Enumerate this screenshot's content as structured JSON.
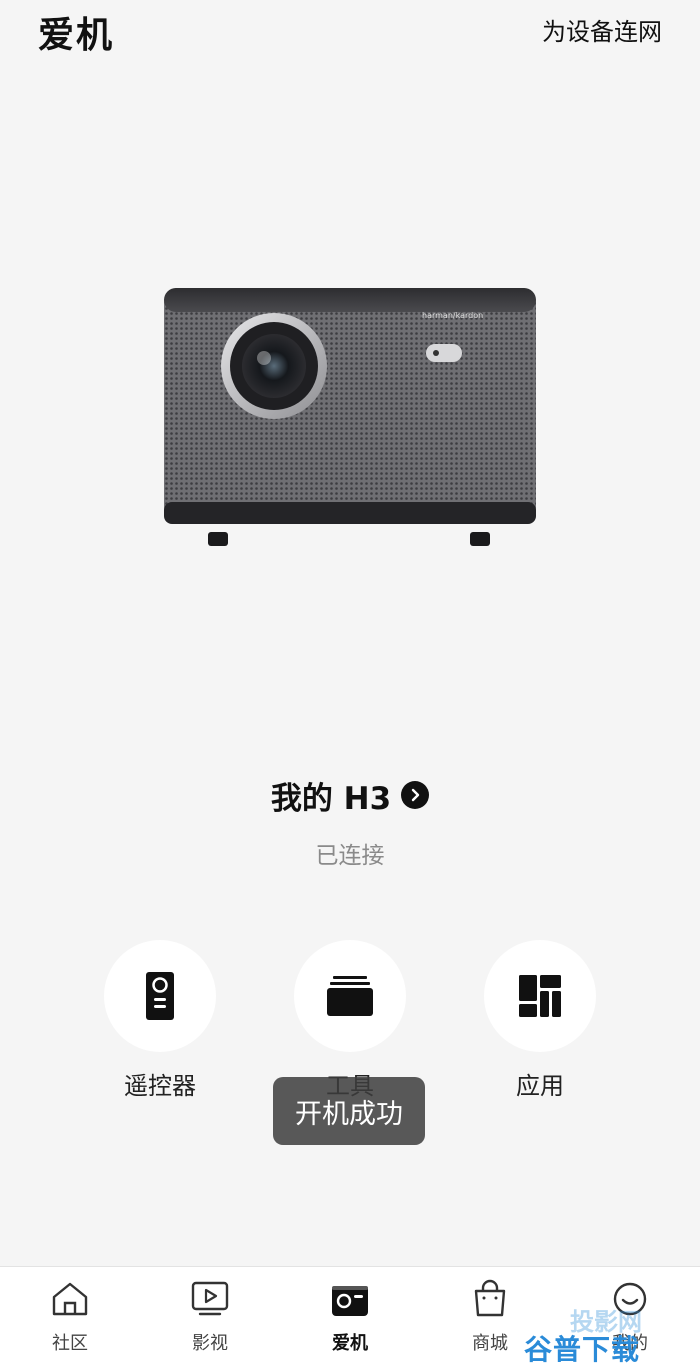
{
  "header": {
    "title": "爱机",
    "network_link": "为设备连网"
  },
  "device": {
    "name": "我的 H3",
    "status": "已连接",
    "brand_mark": "harman/kardon"
  },
  "actions": [
    {
      "label": "遥控器",
      "icon": "remote-control-icon"
    },
    {
      "label": "工具",
      "icon": "tools-icon"
    },
    {
      "label": "应用",
      "icon": "apps-grid-icon"
    }
  ],
  "toast": {
    "text": "开机成功"
  },
  "tabbar": [
    {
      "label": "社区",
      "icon": "home-icon",
      "active": false
    },
    {
      "label": "影视",
      "icon": "video-play-icon",
      "active": false
    },
    {
      "label": "爱机",
      "icon": "projector-icon",
      "active": true
    },
    {
      "label": "商城",
      "icon": "shopping-bag-icon",
      "active": false
    },
    {
      "label": "我的",
      "icon": "smiley-face-icon",
      "active": false
    }
  ],
  "watermark": {
    "text": "谷普下载",
    "text2": "投影网"
  },
  "colors": {
    "background": "#f5f5f5",
    "tabbar": "#ffffff",
    "status_text": "#8a8a8a",
    "watermark": "#2a8bd8"
  }
}
